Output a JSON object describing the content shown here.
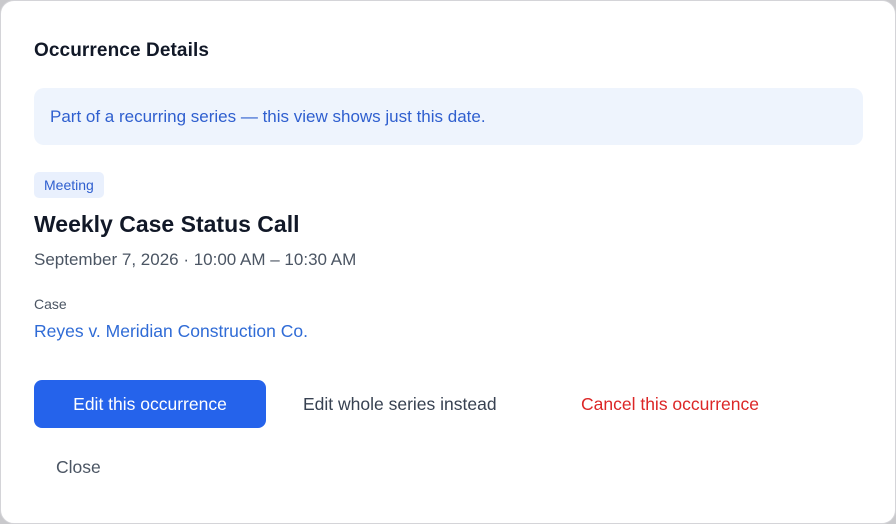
{
  "dialog": {
    "title": "Occurrence Details",
    "banner_text": "Part of a recurring series — this view shows just this date."
  },
  "event": {
    "type_tag": "Meeting",
    "title": "Weekly Case Status Call",
    "datetime": "September 7, 2026 · 10:00 AM – 10:30 AM",
    "case_label": "Case",
    "case_name": "Reyes v. Meridian Construction Co."
  },
  "actions": {
    "edit_occurrence": "Edit this occurrence",
    "edit_series": "Edit whole series instead",
    "cancel_occurrence": "Cancel this occurrence",
    "close": "Close"
  },
  "colors": {
    "primary": "#2563eb",
    "danger": "#dc2626",
    "banner_bg": "#eef4fd",
    "link": "#2f6bd6"
  }
}
